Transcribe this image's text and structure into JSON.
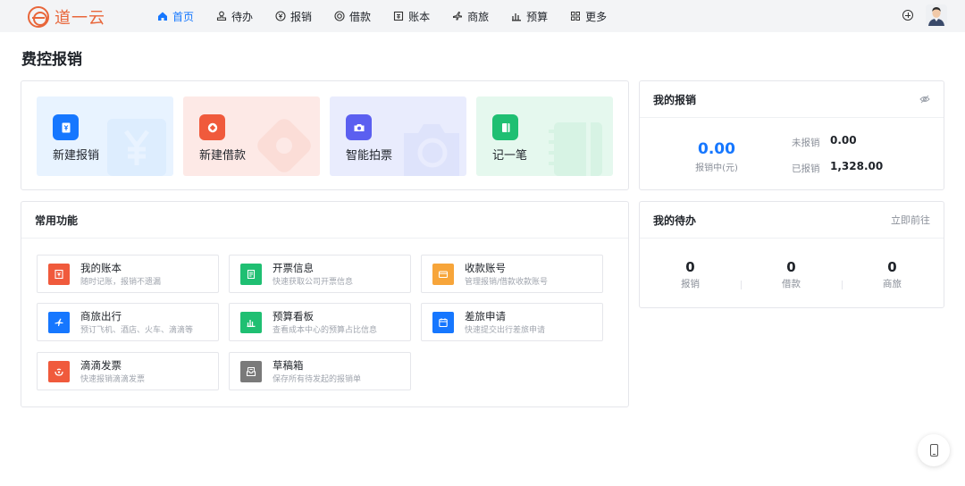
{
  "brand": {
    "name": "道一云"
  },
  "nav": [
    {
      "label": "首页",
      "icon": "home-icon",
      "active": true
    },
    {
      "label": "待办",
      "icon": "stamp-icon"
    },
    {
      "label": "报销",
      "icon": "yen-coin-icon"
    },
    {
      "label": "借款",
      "icon": "target-icon"
    },
    {
      "label": "账本",
      "icon": "ledger-icon"
    },
    {
      "label": "商旅",
      "icon": "airplane-icon"
    },
    {
      "label": "预算",
      "icon": "bar-chart-icon"
    },
    {
      "label": "更多",
      "icon": "grid-icon"
    }
  ],
  "page": {
    "title": "费控报销"
  },
  "quick_actions": [
    {
      "label": "新建报销",
      "icon": "yen-receipt-icon",
      "color": "#1677ff",
      "bg": "#e8f3ff"
    },
    {
      "label": "新建借款",
      "icon": "loan-icon",
      "color": "#f05a3c",
      "bg": "#fde9e6"
    },
    {
      "label": "智能拍票",
      "icon": "camera-icon",
      "color": "#5b5ff0",
      "bg": "#e9ecfd"
    },
    {
      "label": "记一笔",
      "icon": "notebook-icon",
      "color": "#1fbf72",
      "bg": "#e5f8ee"
    }
  ],
  "my_reimburse": {
    "title": "我的报销",
    "in_progress_amount": "0.00",
    "in_progress_label": "报销中(元)",
    "unreimbursed_label": "未报销",
    "unreimbursed_value": "0.00",
    "reimbursed_label": "已报销",
    "reimbursed_value": "1,328.00"
  },
  "common": {
    "title": "常用功能",
    "items": [
      {
        "title": "我的账本",
        "desc": "随时记账，报销不遗漏",
        "icon": "ledger-icon",
        "color": "#f05a3c"
      },
      {
        "title": "开票信息",
        "desc": "快速获取公司开票信息",
        "icon": "invoice-icon",
        "color": "#1fbf72"
      },
      {
        "title": "收款账号",
        "desc": "管理报销/借款收款账号",
        "icon": "card-icon",
        "color": "#f7a53a"
      },
      {
        "title": "商旅出行",
        "desc": "预订飞机、酒店、火车、滴滴等",
        "icon": "airplane-icon",
        "color": "#1677ff"
      },
      {
        "title": "预算看板",
        "desc": "查看成本中心的预算占比信息",
        "icon": "bar-chart-icon",
        "color": "#1fbf72"
      },
      {
        "title": "差旅申请",
        "desc": "快速提交出行差旅申请",
        "icon": "calendar-icon",
        "color": "#1677ff"
      },
      {
        "title": "滴滴发票",
        "desc": "快速报销滴滴发票",
        "icon": "didi-icon",
        "color": "#f05a3c"
      },
      {
        "title": "草稿箱",
        "desc": "保存所有待发起的报销单",
        "icon": "draft-box-icon",
        "color": "#7a7a7a"
      }
    ]
  },
  "todo": {
    "title": "我的待办",
    "link": "立即前往",
    "items": [
      {
        "count": "0",
        "label": "报销"
      },
      {
        "count": "0",
        "label": "借款"
      },
      {
        "count": "0",
        "label": "商旅"
      }
    ]
  }
}
